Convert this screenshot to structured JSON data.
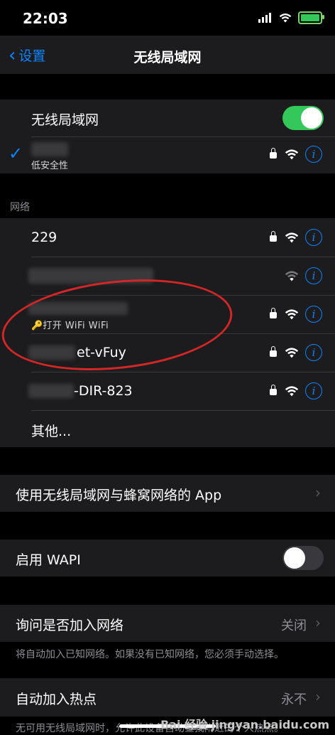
{
  "status_bar": {
    "time": "22:03"
  },
  "nav": {
    "back_label": "设置",
    "title": "无线局域网"
  },
  "wifi_toggle": {
    "label": "无线局域网",
    "on": true
  },
  "connected": {
    "subtitle": "低安全性"
  },
  "networks_header": "网络",
  "networks": [
    {
      "name": "229",
      "secured": true
    },
    {
      "name": "",
      "secured": false
    },
    {
      "name": "",
      "subtitle": "打开 WiFi WiFi",
      "secured": true
    },
    {
      "name": "et-vFuy",
      "secured": true
    },
    {
      "name": "-DIR-823",
      "secured": true
    }
  ],
  "other_label": "其他...",
  "apps_row": "使用无线局域网与蜂窝网络的 App",
  "wapi": {
    "label": "启用 WAPI",
    "on": false
  },
  "ask_join": {
    "label": "询问是否加入网络",
    "value": "关闭",
    "footnote": "将自动加入已知网络。如果没有已知网络，您必须手动选择。"
  },
  "hotspot": {
    "label": "自动加入热点",
    "value": "永不",
    "footnote": "无可用无线局域网时，允许此设备自动查找附近的个人热点。"
  },
  "watermark": "Bai 经验 jingyan.baidu.com",
  "colors": {
    "accent": "#0a84ff",
    "toggle_on": "#34c759",
    "annotation": "#d32626"
  }
}
